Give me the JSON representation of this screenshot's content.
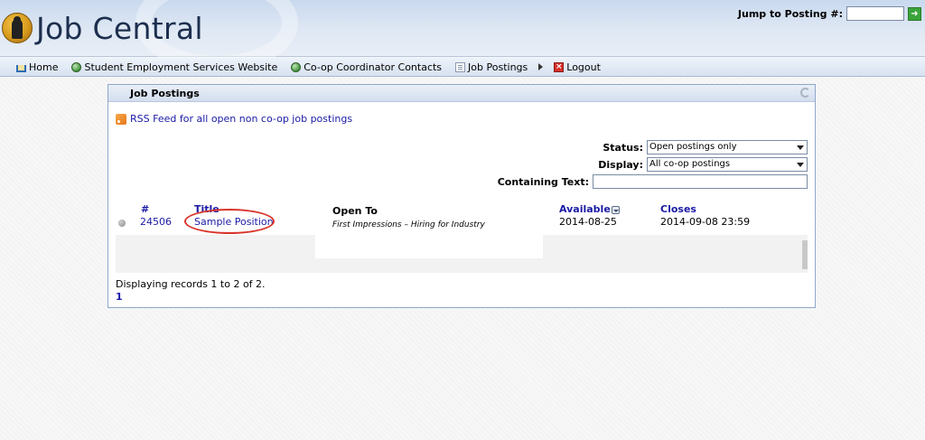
{
  "app": {
    "title": "Job Central"
  },
  "jump": {
    "label": "Jump to Posting #:",
    "go_icon": "arrow-right-icon"
  },
  "nav": {
    "items": [
      {
        "label": "Home",
        "icon": "home-icon"
      },
      {
        "label": "Student Employment Services Website",
        "icon": "globe-icon"
      },
      {
        "label": "Co-op Coordinator Contacts",
        "icon": "globe-icon"
      },
      {
        "label": "Job Postings",
        "icon": "document-icon"
      },
      {
        "label": "Logout",
        "icon": "logout-icon"
      }
    ]
  },
  "panel": {
    "title": "Job Postings",
    "rss_label": "RSS Feed for all open non co-op job postings",
    "filters": {
      "status_label": "Status:",
      "status_value": "Open postings only",
      "display_label": "Display:",
      "display_value": "All co-op postings",
      "text_label": "Containing Text:"
    },
    "columns": {
      "number": "#",
      "title": "Title",
      "open_to": "Open To",
      "available": "Available",
      "closes": "Closes"
    },
    "rows": [
      {
        "number": "24506",
        "title": "Sample Position",
        "open_to": "First Impressions – Hiring for Industry",
        "available": "2014-08-25",
        "closes": "2014-09-08 23:59"
      }
    ],
    "records_text": "Displaying records 1 to 2 of 2.",
    "page": "1"
  },
  "colors": {
    "accent": "#1a1aa6",
    "annotation": "#d9342b"
  }
}
